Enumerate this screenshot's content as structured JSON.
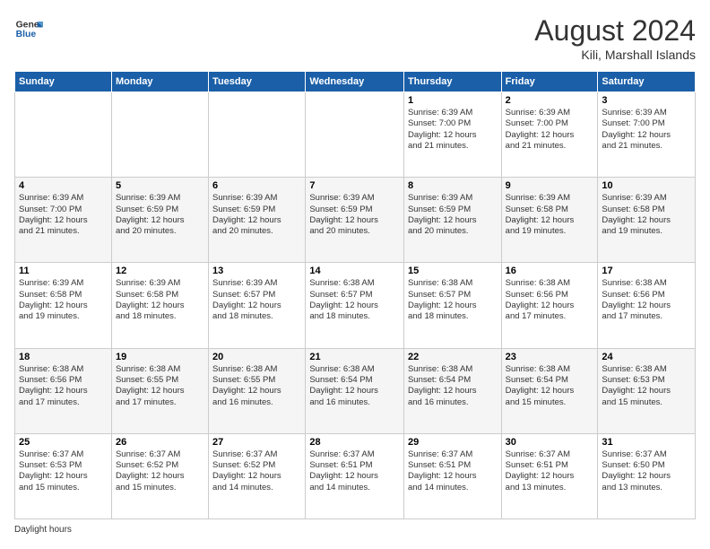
{
  "header": {
    "logo_line1": "General",
    "logo_line2": "Blue",
    "month_year": "August 2024",
    "location": "Kili, Marshall Islands"
  },
  "weekdays": [
    "Sunday",
    "Monday",
    "Tuesday",
    "Wednesday",
    "Thursday",
    "Friday",
    "Saturday"
  ],
  "weeks": [
    [
      {
        "num": "",
        "info": ""
      },
      {
        "num": "",
        "info": ""
      },
      {
        "num": "",
        "info": ""
      },
      {
        "num": "",
        "info": ""
      },
      {
        "num": "1",
        "info": "Sunrise: 6:39 AM\nSunset: 7:00 PM\nDaylight: 12 hours\nand 21 minutes."
      },
      {
        "num": "2",
        "info": "Sunrise: 6:39 AM\nSunset: 7:00 PM\nDaylight: 12 hours\nand 21 minutes."
      },
      {
        "num": "3",
        "info": "Sunrise: 6:39 AM\nSunset: 7:00 PM\nDaylight: 12 hours\nand 21 minutes."
      }
    ],
    [
      {
        "num": "4",
        "info": "Sunrise: 6:39 AM\nSunset: 7:00 PM\nDaylight: 12 hours\nand 21 minutes."
      },
      {
        "num": "5",
        "info": "Sunrise: 6:39 AM\nSunset: 6:59 PM\nDaylight: 12 hours\nand 20 minutes."
      },
      {
        "num": "6",
        "info": "Sunrise: 6:39 AM\nSunset: 6:59 PM\nDaylight: 12 hours\nand 20 minutes."
      },
      {
        "num": "7",
        "info": "Sunrise: 6:39 AM\nSunset: 6:59 PM\nDaylight: 12 hours\nand 20 minutes."
      },
      {
        "num": "8",
        "info": "Sunrise: 6:39 AM\nSunset: 6:59 PM\nDaylight: 12 hours\nand 20 minutes."
      },
      {
        "num": "9",
        "info": "Sunrise: 6:39 AM\nSunset: 6:58 PM\nDaylight: 12 hours\nand 19 minutes."
      },
      {
        "num": "10",
        "info": "Sunrise: 6:39 AM\nSunset: 6:58 PM\nDaylight: 12 hours\nand 19 minutes."
      }
    ],
    [
      {
        "num": "11",
        "info": "Sunrise: 6:39 AM\nSunset: 6:58 PM\nDaylight: 12 hours\nand 19 minutes."
      },
      {
        "num": "12",
        "info": "Sunrise: 6:39 AM\nSunset: 6:58 PM\nDaylight: 12 hours\nand 18 minutes."
      },
      {
        "num": "13",
        "info": "Sunrise: 6:39 AM\nSunset: 6:57 PM\nDaylight: 12 hours\nand 18 minutes."
      },
      {
        "num": "14",
        "info": "Sunrise: 6:38 AM\nSunset: 6:57 PM\nDaylight: 12 hours\nand 18 minutes."
      },
      {
        "num": "15",
        "info": "Sunrise: 6:38 AM\nSunset: 6:57 PM\nDaylight: 12 hours\nand 18 minutes."
      },
      {
        "num": "16",
        "info": "Sunrise: 6:38 AM\nSunset: 6:56 PM\nDaylight: 12 hours\nand 17 minutes."
      },
      {
        "num": "17",
        "info": "Sunrise: 6:38 AM\nSunset: 6:56 PM\nDaylight: 12 hours\nand 17 minutes."
      }
    ],
    [
      {
        "num": "18",
        "info": "Sunrise: 6:38 AM\nSunset: 6:56 PM\nDaylight: 12 hours\nand 17 minutes."
      },
      {
        "num": "19",
        "info": "Sunrise: 6:38 AM\nSunset: 6:55 PM\nDaylight: 12 hours\nand 17 minutes."
      },
      {
        "num": "20",
        "info": "Sunrise: 6:38 AM\nSunset: 6:55 PM\nDaylight: 12 hours\nand 16 minutes."
      },
      {
        "num": "21",
        "info": "Sunrise: 6:38 AM\nSunset: 6:54 PM\nDaylight: 12 hours\nand 16 minutes."
      },
      {
        "num": "22",
        "info": "Sunrise: 6:38 AM\nSunset: 6:54 PM\nDaylight: 12 hours\nand 16 minutes."
      },
      {
        "num": "23",
        "info": "Sunrise: 6:38 AM\nSunset: 6:54 PM\nDaylight: 12 hours\nand 15 minutes."
      },
      {
        "num": "24",
        "info": "Sunrise: 6:38 AM\nSunset: 6:53 PM\nDaylight: 12 hours\nand 15 minutes."
      }
    ],
    [
      {
        "num": "25",
        "info": "Sunrise: 6:37 AM\nSunset: 6:53 PM\nDaylight: 12 hours\nand 15 minutes."
      },
      {
        "num": "26",
        "info": "Sunrise: 6:37 AM\nSunset: 6:52 PM\nDaylight: 12 hours\nand 15 minutes."
      },
      {
        "num": "27",
        "info": "Sunrise: 6:37 AM\nSunset: 6:52 PM\nDaylight: 12 hours\nand 14 minutes."
      },
      {
        "num": "28",
        "info": "Sunrise: 6:37 AM\nSunset: 6:51 PM\nDaylight: 12 hours\nand 14 minutes."
      },
      {
        "num": "29",
        "info": "Sunrise: 6:37 AM\nSunset: 6:51 PM\nDaylight: 12 hours\nand 14 minutes."
      },
      {
        "num": "30",
        "info": "Sunrise: 6:37 AM\nSunset: 6:51 PM\nDaylight: 12 hours\nand 13 minutes."
      },
      {
        "num": "31",
        "info": "Sunrise: 6:37 AM\nSunset: 6:50 PM\nDaylight: 12 hours\nand 13 minutes."
      }
    ]
  ],
  "legend": {
    "daylight_label": "Daylight hours"
  }
}
